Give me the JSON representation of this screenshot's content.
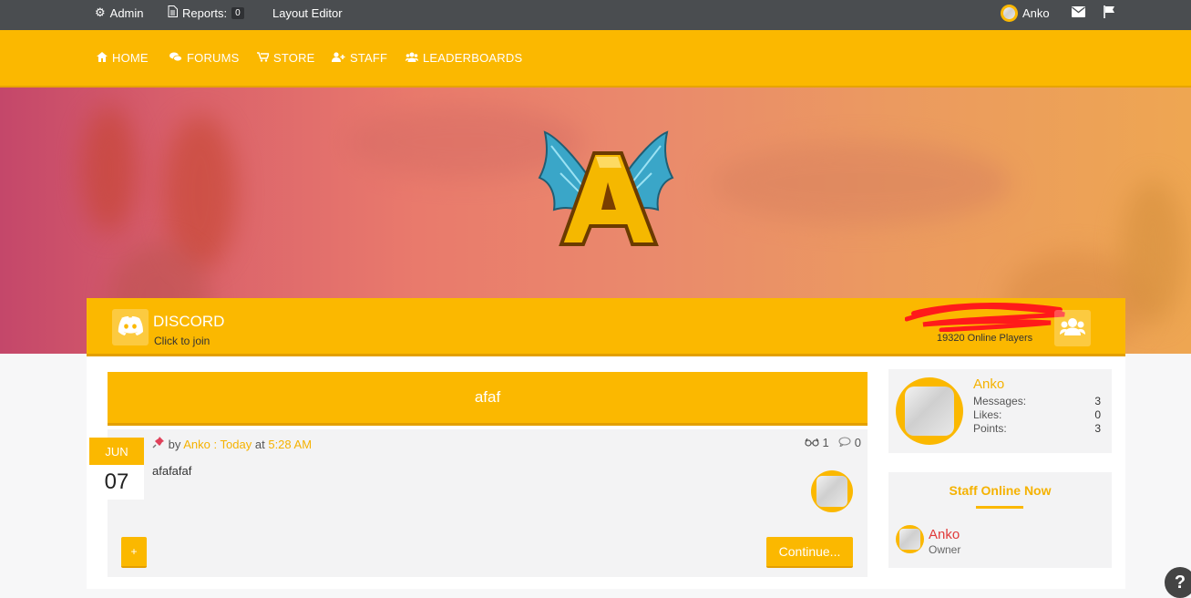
{
  "topbar": {
    "admin": "Admin",
    "reports": "Reports:",
    "reports_count": "0",
    "layout_editor": "Layout Editor",
    "user": "Anko"
  },
  "nav": {
    "home": "HOME",
    "forums": "FORUMS",
    "store": "STORE",
    "staff": "STAFF",
    "leaderboards": "LEADERBOARDS"
  },
  "discord": {
    "title": "DISCORD",
    "subtitle": "Click to join",
    "online": "19320 Online Players"
  },
  "post": {
    "title": "afaf",
    "month": "JUN",
    "day": "07",
    "by": "by",
    "author": "Anko",
    "sep": ":",
    "date": "Today",
    "at": "at",
    "time": "5:28 AM",
    "views": "1",
    "comments": "0",
    "body": "afafafaf",
    "plus": "+",
    "continue": "Continue..."
  },
  "profile": {
    "name": "Anko",
    "messages_label": "Messages:",
    "messages": "3",
    "likes_label": "Likes:",
    "likes": "0",
    "points_label": "Points:",
    "points": "3"
  },
  "staff": {
    "title": "Staff Online Now",
    "name": "Anko",
    "role": "Owner"
  },
  "help": "?",
  "colors": {
    "accent": "#fbb800",
    "topbar": "#4a4d50",
    "staff_name": "#e03a3a"
  }
}
